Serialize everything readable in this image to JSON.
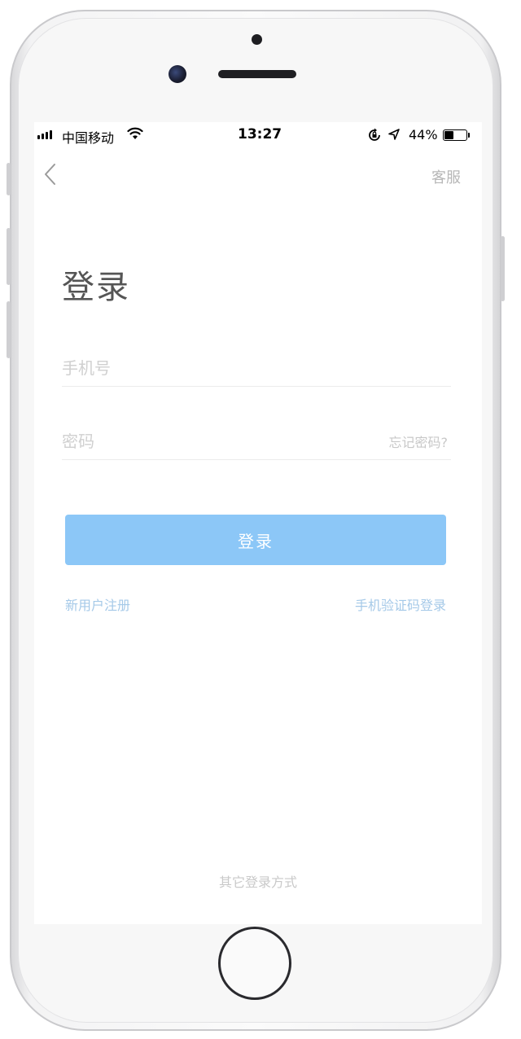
{
  "status_bar": {
    "carrier": "中国移动",
    "time": "13:27",
    "battery_percent": "44%",
    "battery_level": 0.44,
    "icons": [
      "signal-icon",
      "wifi-icon",
      "rotation-lock-icon",
      "location-icon",
      "battery-icon"
    ]
  },
  "nav": {
    "back_icon": "chevron-left-icon",
    "service_label": "客服"
  },
  "page": {
    "title": "登录"
  },
  "form": {
    "phone_placeholder": "手机号",
    "phone_value": "",
    "password_placeholder": "密码",
    "password_value": "",
    "forgot_label": "忘记密码?",
    "login_button": "登录"
  },
  "links": {
    "register": "新用户注册",
    "sms_login": "手机验证码登录"
  },
  "footer": {
    "other_methods": "其它登录方式"
  },
  "colors": {
    "primary_button": "#8cc7f7",
    "link": "#a5c9e8",
    "placeholder": "#d0d0d0",
    "title": "#555555"
  }
}
